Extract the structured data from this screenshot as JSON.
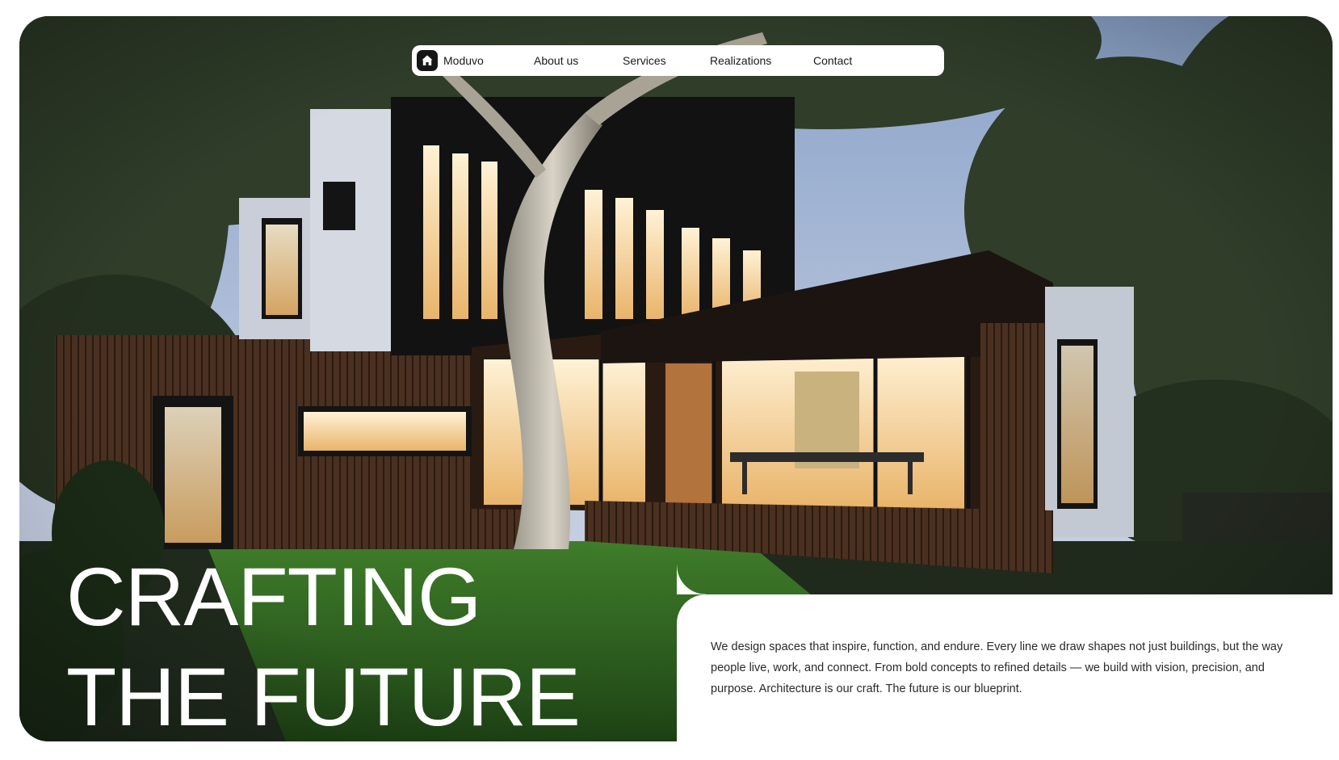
{
  "nav": {
    "brand": "Moduvo",
    "logo_icon": "house-icon",
    "links": [
      "About us",
      "Services",
      "Realizations",
      "Contact"
    ]
  },
  "hero": {
    "headline_line1": "CRAFTING",
    "headline_line2": "THE FUTURE",
    "image": "modern-house-photo"
  },
  "info": {
    "description": "We design spaces that inspire, function, and endure. Every line we draw shapes not just buildings, but the way people live, work, and connect. From bold concepts to refined details — we build with vision, precision, and purpose. Architecture is our craft. The future is our blueprint."
  },
  "colors": {
    "nav_background": "#ffffff",
    "logo_background": "#161616",
    "headline_text": "#ffffff",
    "panel_background": "#ffffff",
    "body_text": "#2a2a2a"
  }
}
